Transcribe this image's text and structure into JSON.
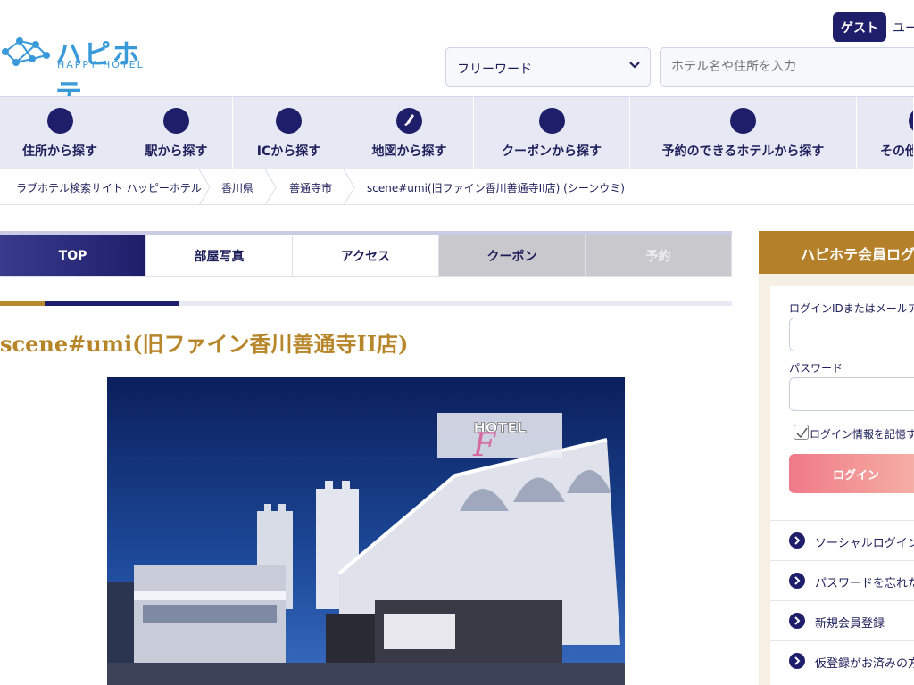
{
  "header": {
    "logo_main": "ハピホテ",
    "logo_sub": "HAPPY HOTEL",
    "guest_label": "ゲスト",
    "user_text": "ユー",
    "search_select": "フリーワード",
    "search_placeholder": "ホテル名や住所を入力"
  },
  "nav": {
    "items": [
      {
        "label": "住所から探す"
      },
      {
        "label": "駅から探す"
      },
      {
        "label": "ICから探す"
      },
      {
        "label": "地図から探す"
      },
      {
        "label": "クーポンから探す"
      },
      {
        "label": "予約のできるホテルから探す"
      },
      {
        "label": "その他"
      }
    ]
  },
  "breadcrumb": [
    "ラブホテル検索サイト ハッピーホテル",
    "香川県",
    "善通寺市",
    "scene#umi(旧ファイン香川善通寺II店) (シーンウミ)"
  ],
  "tabs": [
    {
      "label": "TOP"
    },
    {
      "label": "部屋写真"
    },
    {
      "label": "アクセス"
    },
    {
      "label": "クーポン"
    },
    {
      "label": "予約"
    }
  ],
  "hotel": {
    "title": "scene#umi(旧ファイン香川善通寺II店)",
    "sign_text": "HOTEL"
  },
  "sidebar": {
    "login_title": "ハピホテ会員ログ",
    "id_label": "ログインIDまたはメールアドレ",
    "password_label": "パスワード",
    "remember_label": "ログイン情報を記憶す",
    "login_button": "ログイン",
    "links": [
      {
        "label": "ソーシャルログイン"
      },
      {
        "label": "パスワードを忘れた方"
      },
      {
        "label": "新規会員登録"
      },
      {
        "label": "仮登録がお済みの方"
      }
    ]
  },
  "colors": {
    "navy": "#1e1e6a",
    "gold": "#b5802a",
    "nav_bg": "#e6e8f4",
    "login_gradient_start": "#f07a88"
  }
}
